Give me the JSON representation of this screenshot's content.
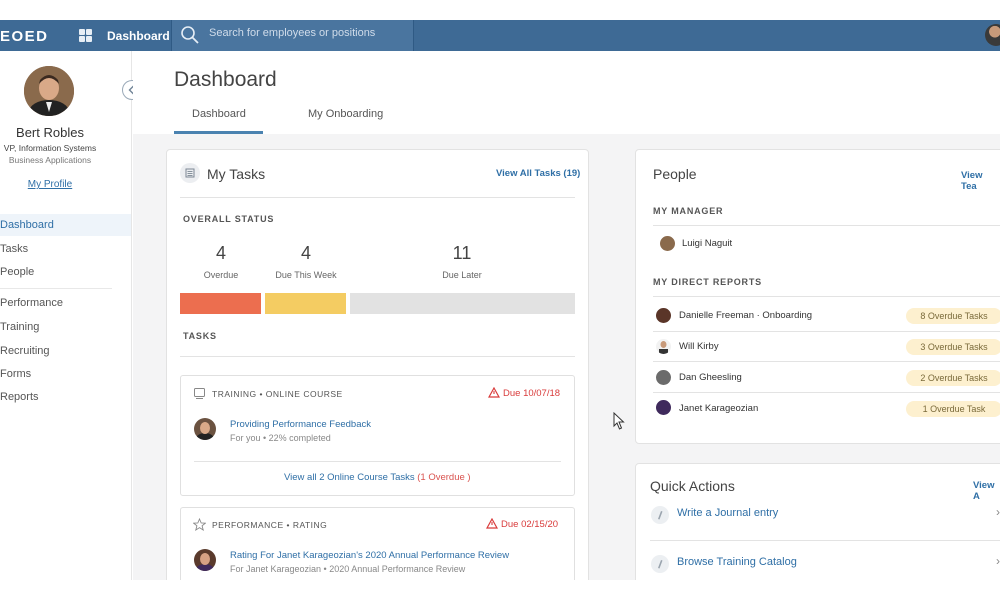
{
  "topbar": {
    "logo": "EOED",
    "nav_label": "Dashboard",
    "search_placeholder": "Search for employees or positions"
  },
  "sidebar": {
    "user_name": "Bert Robles",
    "user_title": "VP, Information Systems",
    "user_dept": "Business Applications",
    "profile_link": "My Profile",
    "menu": [
      {
        "label": "Dashboard",
        "active": true
      },
      {
        "label": "Tasks"
      },
      {
        "label": "People"
      },
      {
        "label": "Performance"
      },
      {
        "label": "Training"
      },
      {
        "label": "Recruiting"
      },
      {
        "label": "Forms"
      },
      {
        "label": "Reports"
      }
    ]
  },
  "header": {
    "title": "Dashboard",
    "tabs": [
      {
        "label": "Dashboard",
        "active": true
      },
      {
        "label": "My Onboarding"
      }
    ]
  },
  "tasks_card": {
    "title": "My Tasks",
    "view_all": "View All Tasks (19)",
    "overall_label": "OVERALL STATUS",
    "stats": [
      {
        "value": "4",
        "label": "Overdue",
        "color": "#ec6e4f"
      },
      {
        "value": "4",
        "label": "Due This Week",
        "color": "#f4cc62"
      },
      {
        "value": "11",
        "label": "Due Later",
        "color": "#e2e2e2"
      }
    ],
    "tasks_label": "TASKS",
    "items": [
      {
        "type": "TRAINING • ONLINE COURSE",
        "due": "Due 10/07/18",
        "title": "Providing Performance Feedback",
        "sub": "For you • 22% completed",
        "footer_link": "View all 2 Online Course Tasks",
        "footer_note": "(1 Overdue )"
      },
      {
        "type": "PERFORMANCE • RATING",
        "due": "Due 02/15/20",
        "title": "Rating For Janet Karageozian's 2020 Annual Performance Review",
        "sub": "For Janet Karageozian • 2020 Annual Performance Review"
      }
    ]
  },
  "people_card": {
    "title": "People",
    "view_all": "View Tea",
    "manager_label": "MY MANAGER",
    "manager": "Luigi Naguit",
    "reports_label": "MY DIRECT REPORTS",
    "reports": [
      {
        "name": "Danielle Freeman · Onboarding",
        "badge": "8 Overdue Tasks"
      },
      {
        "name": "Will Kirby",
        "badge": "3 Overdue Tasks"
      },
      {
        "name": "Dan Gheesling",
        "badge": "2 Overdue Tasks"
      },
      {
        "name": "Janet Karageozian",
        "badge": "1 Overdue Task"
      }
    ]
  },
  "quick_actions": {
    "title": "Quick Actions",
    "view_all": "View A",
    "items": [
      {
        "label": "Write a Journal entry"
      },
      {
        "label": "Browse Training Catalog"
      }
    ]
  }
}
